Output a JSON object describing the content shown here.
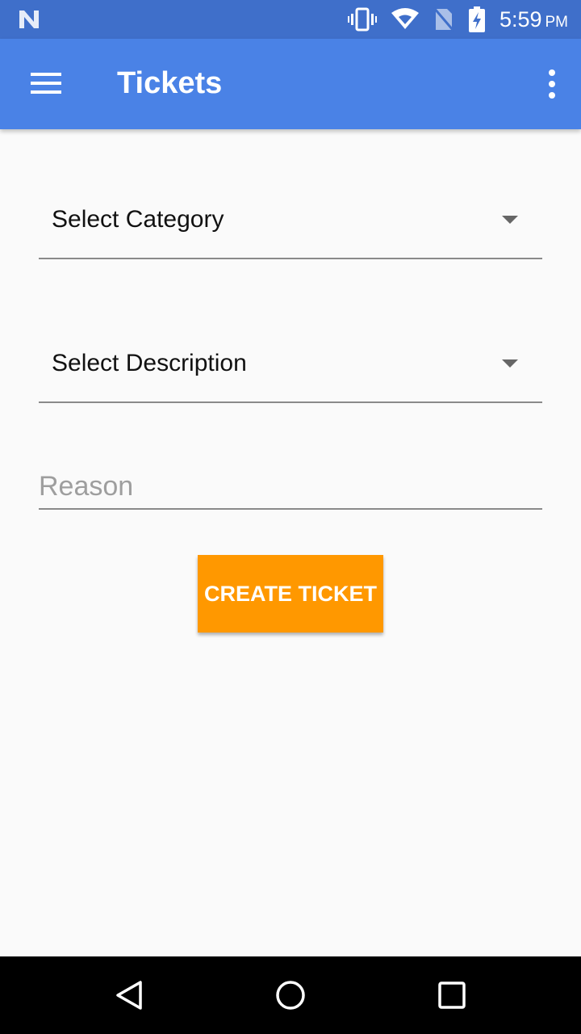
{
  "status_bar": {
    "time": "5:59",
    "ampm": "PM",
    "icons": [
      "notification-n-icon",
      "vibrate-icon",
      "wifi-icon",
      "no-sim-icon",
      "battery-charging-icon"
    ]
  },
  "app_bar": {
    "title": "Tickets",
    "icons": [
      "menu-icon",
      "overflow-menu-icon"
    ]
  },
  "form": {
    "category_spinner": {
      "selected": "Select Category"
    },
    "description_spinner": {
      "selected": "Select Description"
    },
    "reason": {
      "placeholder": "Reason",
      "value": ""
    },
    "create_button_label": "CREATE TICKET"
  },
  "nav_bar": {
    "icons": [
      "back-icon",
      "home-icon",
      "recents-icon"
    ]
  },
  "colors": {
    "status_bar": "#3f6fca",
    "app_bar": "#4a82e6",
    "accent_button": "#ff9800",
    "background": "#fafafa"
  }
}
